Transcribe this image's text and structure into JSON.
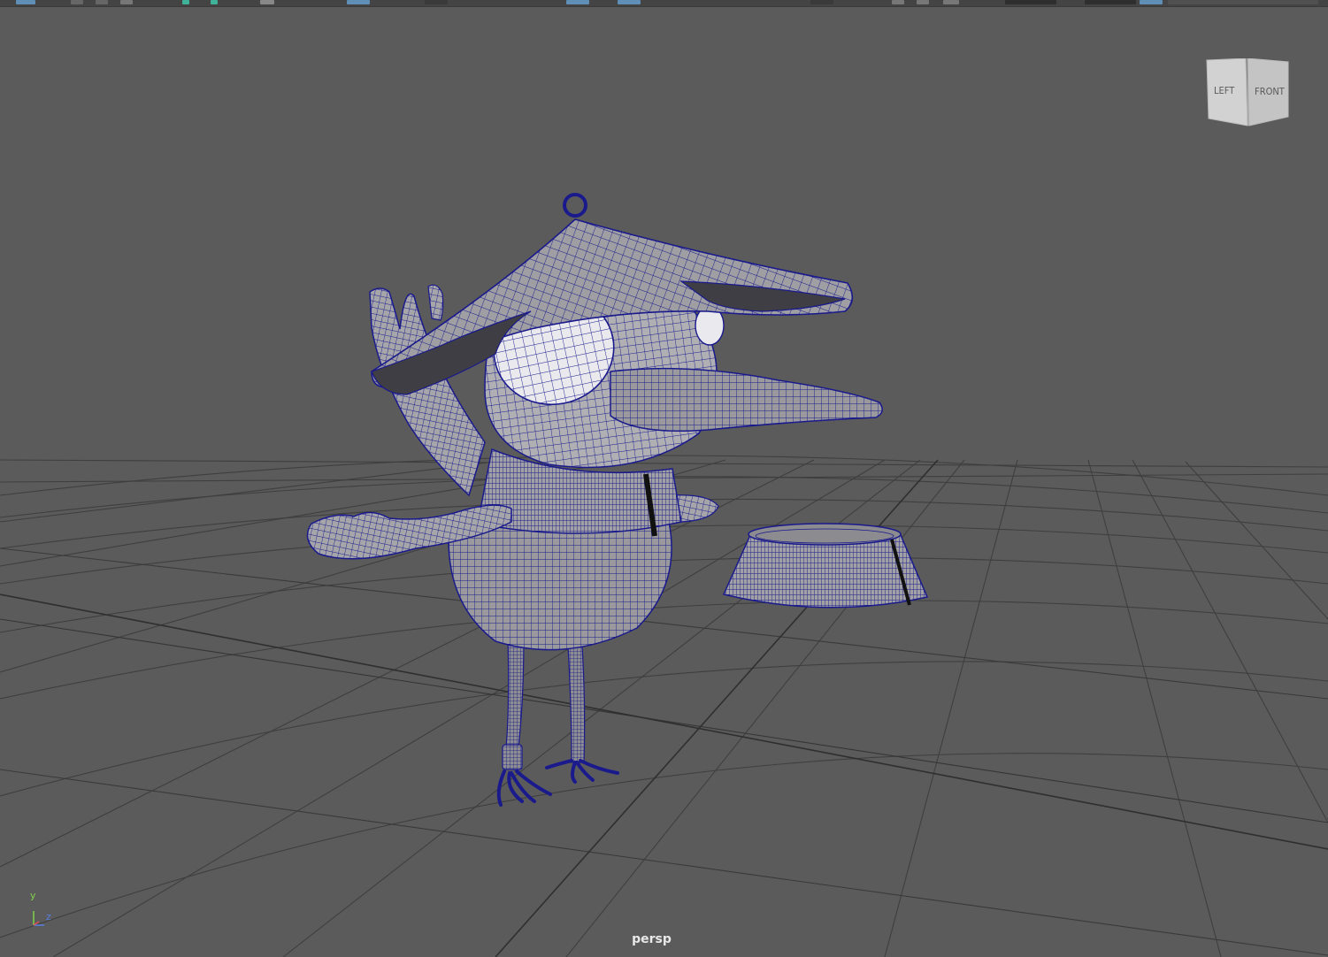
{
  "viewport": {
    "camera_label": "persp",
    "background_color": "#5b5b5b",
    "grid_color": "#3d3d3d",
    "wireframe_color": "#1a1a8c"
  },
  "viewcube": {
    "left_face_label": "LEFT",
    "front_face_label": "FRONT"
  },
  "axis_gizmo": {
    "y_label": "y",
    "z_label": "z",
    "y_color": "#7fd24a",
    "z_color": "#5a7fe0"
  },
  "scene": {
    "objects": [
      "bird-character",
      "conical-hat",
      "collar-ring"
    ]
  }
}
